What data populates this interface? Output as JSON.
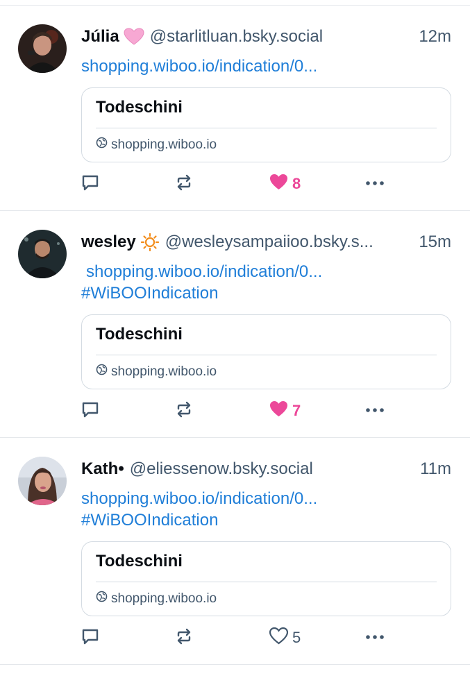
{
  "colors": {
    "link": "#1f7ed8",
    "muted": "#42576c",
    "liked": "#ec4899",
    "border": "#e4e7eb"
  },
  "posts": [
    {
      "display_name": "Júlia",
      "name_emoji": "pink-heart",
      "handle": "@starlitluan.bsky.social",
      "time": "12m",
      "link_text": "shopping.wiboo.io/indication/0...",
      "hashtag": "",
      "card": {
        "title": "Todeschini",
        "domain": "shopping.wiboo.io"
      },
      "like_count": "8",
      "liked": true
    },
    {
      "display_name": "wesley",
      "name_emoji": "sun",
      "handle": "@wesleysampaiioo.bsky.s...",
      "time": "15m",
      "link_text": "shopping.wiboo.io/indication/0...",
      "hashtag": "#WiBOOIndication",
      "card": {
        "title": "Todeschini",
        "domain": "shopping.wiboo.io"
      },
      "like_count": "7",
      "liked": true
    },
    {
      "display_name": "Kath•",
      "name_emoji": "",
      "handle": "@eliessenow.bsky.social",
      "time": "11m",
      "link_text": "shopping.wiboo.io/indication/0...",
      "hashtag": "#WiBOOIndication",
      "card": {
        "title": "Todeschini",
        "domain": "shopping.wiboo.io"
      },
      "like_count": "5",
      "liked": false
    }
  ],
  "icons": {
    "reply": "reply-icon",
    "repost": "repost-icon",
    "like": "heart-icon",
    "more": "more-icon",
    "globe": "globe-icon"
  }
}
